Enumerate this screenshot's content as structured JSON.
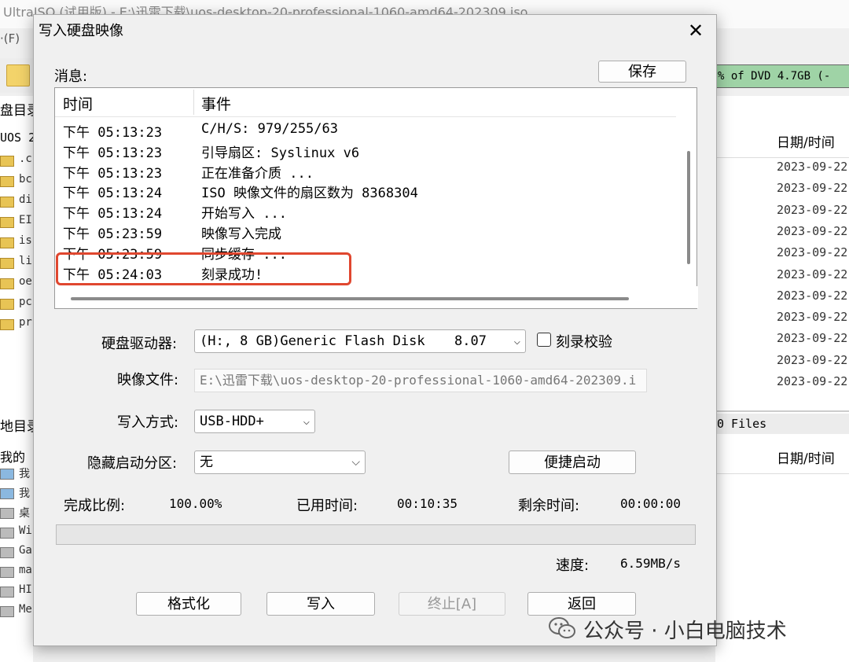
{
  "background_app": {
    "title": "UltraISO (试用版) - E:\\迅雷下载\\uos-desktop-20-professional-1060-amd64-202309.iso",
    "menu_first": "·(F)",
    "capacity": "% of DVD 4.7GB (-",
    "left_header_1": "盘目录",
    "left_root": "UOS 2",
    "left_items": [
      ".c",
      "bc",
      "di",
      "EI",
      "is",
      "li",
      "oe",
      "pc",
      "pr"
    ],
    "left_header_2": "地目录",
    "left_subheader": "我的",
    "left_items_2": [
      "我",
      "我",
      "桌",
      "Wi",
      "Ga",
      "ma",
      "HI",
      "Me"
    ],
    "right_header": "日期/时间",
    "dates": [
      "2023-09-22",
      "2023-09-22",
      "2023-09-22",
      "2023-09-22",
      "2023-09-22",
      "2023-09-22",
      "2023-09-22",
      "2023-09-22",
      "2023-09-22",
      "2023-09-22",
      "2023-09-22"
    ],
    "files_label": "0 Files",
    "right_header_2": "日期/时间"
  },
  "dialog": {
    "title": "写入硬盘映像",
    "close_symbol": "✕",
    "messages_label": "消息:",
    "save_button": "保存",
    "log": {
      "col_time": "时间",
      "col_event": "事件",
      "rows": [
        {
          "time": "下午 05:13:23",
          "event": "C/H/S: 979/255/63"
        },
        {
          "time": "下午 05:13:23",
          "event": "引导扇区: Syslinux v6"
        },
        {
          "time": "下午 05:13:23",
          "event": "正在准备介质 ..."
        },
        {
          "time": "下午 05:13:24",
          "event": "ISO 映像文件的扇区数为 8368304"
        },
        {
          "time": "下午 05:13:24",
          "event": "开始写入 ..."
        },
        {
          "time": "下午 05:23:59",
          "event": "映像写入完成"
        },
        {
          "time": "下午 05:23:59",
          "event": "同步缓存 ..."
        },
        {
          "time": "下午 05:24:03",
          "event": "刻录成功!"
        }
      ]
    },
    "drive_label": "硬盘驱动器:",
    "drive_value": "(H:, 8 GB)Generic Flash Disk",
    "drive_version": "8.07",
    "verify_label": "刻录校验",
    "verify_checked": false,
    "image_label": "映像文件:",
    "image_value": "E:\\迅雷下载\\uos-desktop-20-professional-1060-amd64-202309.i",
    "write_mode_label": "写入方式:",
    "write_mode_value": "USB-HDD+",
    "hidden_label": "隐藏启动分区:",
    "hidden_value": "无",
    "quick_boot_button": "便捷启动",
    "done_label": "完成比例:",
    "done_value": "100.00%",
    "progress_fraction": 1.0,
    "elapsed_label": "已用时间:",
    "elapsed_value": "00:10:35",
    "remaining_label": "剩余时间:",
    "remaining_value": "00:00:00",
    "speed_label": "速度:",
    "speed_value": "6.59MB/s",
    "buttons": {
      "format": "格式化",
      "write": "写入",
      "stop": "终止[A]",
      "back": "返回"
    }
  },
  "watermark": "公众号 · 小白电脑技术",
  "colors": {
    "highlight": "#e0472f",
    "capacity_bar": "#9fd3a6"
  }
}
